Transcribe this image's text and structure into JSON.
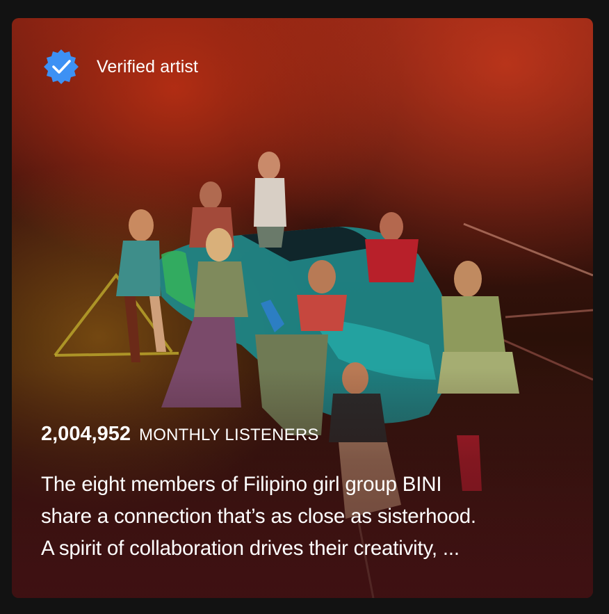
{
  "verified": {
    "label": "Verified artist",
    "icon": "verified-badge-icon",
    "badge_color": "#3d91f4"
  },
  "stats": {
    "monthly_listeners_count": "2,004,952",
    "monthly_listeners_label": "MONTHLY LISTENERS"
  },
  "bio": {
    "line1": "The eight members of Filipino girl group BINI",
    "line2": "share a connection that’s as close as sisterhood.",
    "line3": "A spirit of collaboration drives their creativity, ..."
  },
  "colors": {
    "card_red": "#7a1f12",
    "text": "#ffffff"
  }
}
